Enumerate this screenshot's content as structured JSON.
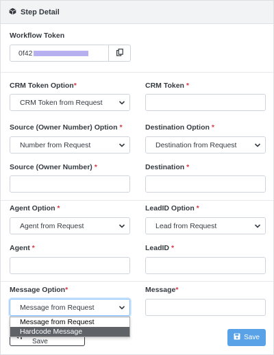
{
  "header": {
    "title": "Step Detail",
    "icon": "cube-icon"
  },
  "workflow_token": {
    "label": "Workflow Token",
    "value_prefix": "0f42",
    "copy_icon": "copy-icon"
  },
  "crm_token_option": {
    "label": "CRM Token Option",
    "required": "*",
    "selected": "CRM Token from Request"
  },
  "crm_token": {
    "label": "CRM Token ",
    "required": "*",
    "value": ""
  },
  "source_option": {
    "label": "Source (Owner Number) Option ",
    "required": "*",
    "selected": "Number from Request"
  },
  "destination_option": {
    "label": "Destination Option ",
    "required": "*",
    "selected": "Destination from Request"
  },
  "source": {
    "label": "Source (Owner Number) ",
    "required": "*",
    "value": ""
  },
  "destination": {
    "label": "Destination ",
    "required": "*",
    "value": ""
  },
  "agent_option": {
    "label": "Agent Option ",
    "required": "*",
    "selected": "Agent from Request"
  },
  "leadid_option": {
    "label": "LeadID Option ",
    "required": "*",
    "selected": "Lead from Request"
  },
  "agent": {
    "label": "Agent ",
    "required": "*",
    "value": ""
  },
  "leadid": {
    "label": "LeadID ",
    "required": "*",
    "value": ""
  },
  "message_option": {
    "label": "Message Option",
    "required": "*",
    "selected": "Message from Request",
    "options": [
      "Message from Request",
      "Hardcode Message"
    ],
    "highlighted": "Hardcode Message"
  },
  "message": {
    "label": "Message",
    "required": "*",
    "value": ""
  },
  "footer": {
    "back_label": "Back without Save",
    "save_label": "Save",
    "save_color": "#5aa2e8"
  }
}
